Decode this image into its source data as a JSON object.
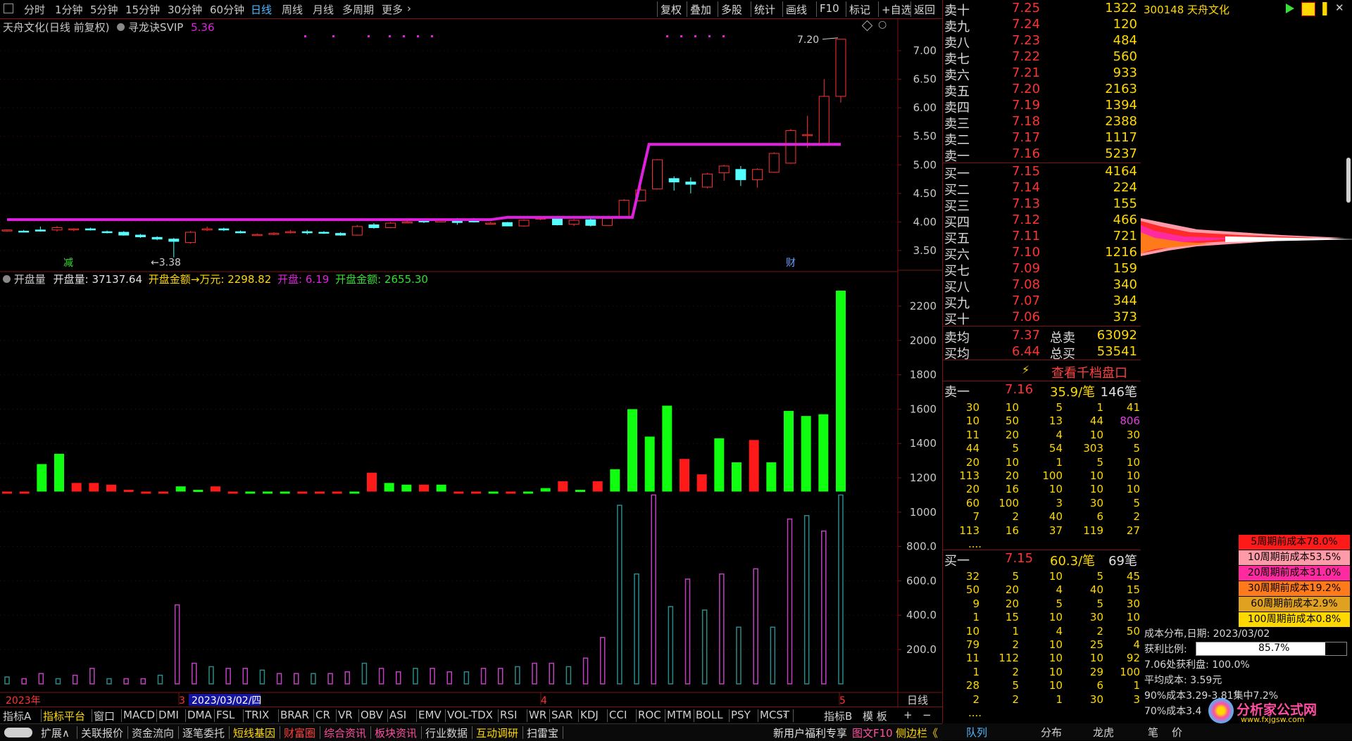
{
  "toolbar": {
    "periods": [
      "分时",
      "1分钟",
      "5分钟",
      "15分钟",
      "30分钟",
      "60分钟",
      "日线",
      "周线",
      "月线",
      "多周期",
      "更多"
    ],
    "active_period": "日线",
    "right_buttons": [
      "复权",
      "叠加",
      "多股",
      "统计",
      "画线",
      "F10",
      "标记",
      "+自选",
      "返回"
    ]
  },
  "main_chart": {
    "title": "天舟文化(日线 前复权)",
    "indicator_name": "寻龙诀SVIP",
    "indicator_value": "5.36",
    "high_label": "7.20",
    "low_label": "3.38",
    "y_ticks": [
      "7.00",
      "6.50",
      "6.00",
      "5.50",
      "5.00",
      "4.50",
      "4.00",
      "3.50"
    ],
    "marker_jian": "减",
    "marker_cai": "财"
  },
  "sub_chart": {
    "name": "开盘量",
    "label1": "开盘量",
    "value1": "37137.64",
    "label2": "开盘金额→万元",
    "value2": "2298.82",
    "label3": "开盘",
    "value3": "6.19",
    "label4": "开盘金额",
    "value4": "2655.30",
    "y_ticks": [
      "2200",
      "2000",
      "1800",
      "1600",
      "1400",
      "1200",
      "1000",
      "800.0",
      "600.0",
      "400.0",
      "200.0"
    ]
  },
  "x_axis": {
    "year_label": "2023年",
    "month3": "3",
    "cursor_date": "2023/03/02/四",
    "month4": "4",
    "month5": "5",
    "period_label": "日线"
  },
  "chart_data": {
    "type": "candlestick",
    "candles": [
      [
        3.85,
        3.87,
        3.83,
        3.86
      ],
      [
        3.84,
        3.86,
        3.82,
        3.83
      ],
      [
        3.86,
        3.92,
        3.83,
        3.84
      ],
      [
        3.86,
        3.93,
        3.83,
        3.9
      ],
      [
        3.87,
        3.89,
        3.84,
        3.88
      ],
      [
        3.88,
        3.9,
        3.85,
        3.86
      ],
      [
        3.83,
        3.85,
        3.8,
        3.82
      ],
      [
        3.82,
        3.84,
        3.76,
        3.77
      ],
      [
        3.77,
        3.79,
        3.72,
        3.74
      ],
      [
        3.73,
        3.75,
        3.68,
        3.7
      ],
      [
        3.7,
        3.72,
        3.38,
        3.66
      ],
      [
        3.64,
        3.84,
        3.62,
        3.82
      ],
      [
        3.86,
        3.92,
        3.84,
        3.88
      ],
      [
        3.88,
        3.9,
        3.84,
        3.86
      ],
      [
        3.83,
        3.85,
        3.8,
        3.81
      ],
      [
        3.78,
        3.8,
        3.76,
        3.78
      ],
      [
        3.79,
        3.82,
        3.77,
        3.8
      ],
      [
        3.82,
        3.86,
        3.8,
        3.83
      ],
      [
        3.83,
        3.86,
        3.78,
        3.81
      ],
      [
        3.82,
        3.84,
        3.79,
        3.81
      ],
      [
        3.8,
        3.82,
        3.76,
        3.77
      ],
      [
        3.77,
        3.95,
        3.76,
        3.92
      ],
      [
        3.95,
        3.98,
        3.88,
        3.9
      ],
      [
        3.9,
        4.0,
        3.89,
        3.98
      ],
      [
        3.99,
        4.02,
        3.98,
        4.0
      ],
      [
        4.02,
        4.04,
        3.98,
        4.0
      ],
      [
        4.0,
        4.05,
        3.99,
        4.03
      ],
      [
        4.05,
        4.07,
        3.95,
        3.99
      ],
      [
        4.02,
        4.07,
        3.99,
        4.0
      ],
      [
        3.97,
        4.0,
        3.96,
        3.98
      ],
      [
        3.99,
        4.0,
        3.93,
        3.93
      ],
      [
        3.93,
        4.04,
        3.92,
        4.03
      ],
      [
        4.05,
        4.09,
        4.03,
        4.08
      ],
      [
        4.06,
        4.08,
        3.94,
        3.95
      ],
      [
        3.96,
        4.05,
        3.93,
        4.03
      ],
      [
        4.04,
        4.08,
        3.92,
        3.94
      ],
      [
        3.94,
        4.07,
        3.94,
        4.06
      ],
      [
        4.09,
        4.4,
        4.08,
        4.38
      ],
      [
        4.37,
        4.62,
        4.36,
        4.56
      ],
      [
        4.58,
        5.1,
        4.57,
        5.09
      ],
      [
        4.76,
        4.8,
        4.55,
        4.7
      ],
      [
        4.7,
        4.78,
        4.5,
        4.66
      ],
      [
        4.61,
        4.86,
        4.59,
        4.84
      ],
      [
        4.86,
        5.0,
        4.72,
        4.98
      ],
      [
        4.92,
        4.98,
        4.63,
        4.74
      ],
      [
        4.74,
        4.94,
        4.6,
        4.92
      ],
      [
        4.87,
        5.22,
        4.86,
        5.2
      ],
      [
        5.03,
        5.63,
        5.02,
        5.6
      ],
      [
        5.53,
        5.86,
        5.3,
        5.53
      ],
      [
        5.36,
        6.5,
        5.35,
        6.2
      ],
      [
        6.2,
        7.2,
        6.09,
        7.2
      ]
    ],
    "trend_line": {
      "level_1": 4.04,
      "level_2": 4.08,
      "level_3": 5.36
    },
    "volume_top_bars": [
      1120,
      1120,
      1280,
      1340,
      1170,
      1170,
      1160,
      1130,
      1120,
      1120,
      1150,
      1130,
      1150,
      1120,
      1120,
      1120,
      1120,
      1120,
      1120,
      1120,
      1120,
      1230,
      1170,
      1160,
      1160,
      1160,
      1120,
      1120,
      1120,
      1120,
      1120,
      1140,
      1180,
      1130,
      1180,
      1250,
      1600,
      1440,
      1620,
      1310,
      1220,
      1430,
      1290,
      1420,
      1290,
      1590,
      1560,
      1570,
      2290
    ],
    "volume_low_bars": [
      40,
      30,
      60,
      30,
      50,
      90,
      30,
      30,
      30,
      50,
      460,
      120,
      100,
      90,
      90,
      80,
      60,
      60,
      60,
      60,
      70,
      120,
      90,
      70,
      90,
      90,
      70,
      70,
      90,
      90,
      100,
      120,
      120,
      100,
      150,
      270,
      1040,
      640,
      1100,
      450,
      610,
      430,
      640,
      330,
      670,
      330,
      960,
      980,
      890,
      1100
    ],
    "ylim_price": [
      3.2,
      7.5
    ],
    "ylim_volume": [
      0,
      2300
    ]
  },
  "order_book": {
    "sells": [
      {
        "label": "卖十",
        "price": "7.25",
        "vol": "1322"
      },
      {
        "label": "卖九",
        "price": "7.24",
        "vol": "120"
      },
      {
        "label": "卖八",
        "price": "7.23",
        "vol": "484"
      },
      {
        "label": "卖七",
        "price": "7.22",
        "vol": "560"
      },
      {
        "label": "卖六",
        "price": "7.21",
        "vol": "933"
      },
      {
        "label": "卖五",
        "price": "7.20",
        "vol": "2163"
      },
      {
        "label": "卖四",
        "price": "7.19",
        "vol": "1394"
      },
      {
        "label": "卖三",
        "price": "7.18",
        "vol": "2388"
      },
      {
        "label": "卖二",
        "price": "7.17",
        "vol": "1117"
      },
      {
        "label": "卖一",
        "price": "7.16",
        "vol": "5237"
      }
    ],
    "buys": [
      {
        "label": "买一",
        "price": "7.15",
        "vol": "4164"
      },
      {
        "label": "买二",
        "price": "7.14",
        "vol": "224"
      },
      {
        "label": "买三",
        "price": "7.13",
        "vol": "155"
      },
      {
        "label": "买四",
        "price": "7.12",
        "vol": "466"
      },
      {
        "label": "买五",
        "price": "7.11",
        "vol": "721"
      },
      {
        "label": "买六",
        "price": "7.10",
        "vol": "1216"
      },
      {
        "label": "买七",
        "price": "7.09",
        "vol": "159"
      },
      {
        "label": "买八",
        "price": "7.08",
        "vol": "340"
      },
      {
        "label": "买九",
        "price": "7.07",
        "vol": "344"
      },
      {
        "label": "买十",
        "price": "7.06",
        "vol": "373"
      }
    ],
    "avg_sell_label": "卖均",
    "avg_sell": "7.37",
    "total_sell_label": "总卖",
    "total_sell": "63092",
    "avg_buy_label": "买均",
    "avg_buy": "6.44",
    "total_buy_label": "总买",
    "total_buy": "53541",
    "view_1000": "查看千档盘口"
  },
  "queue_sell": {
    "label": "卖一",
    "price": "7.16",
    "avg": "35.9/笔",
    "count": "146笔",
    "rows": [
      [
        "30",
        "10",
        "5",
        "1",
        "41"
      ],
      [
        "10",
        "50",
        "13",
        "44",
        "806"
      ],
      [
        "11",
        "20",
        "4",
        "10",
        "30"
      ],
      [
        "44",
        "5",
        "54",
        "303",
        "5"
      ],
      [
        "20",
        "10",
        "1",
        "5",
        "10"
      ],
      [
        "113",
        "20",
        "100",
        "10",
        "10"
      ],
      [
        "20",
        "16",
        "10",
        "10",
        "10"
      ],
      [
        "60",
        "100",
        "3",
        "30",
        "5"
      ],
      [
        "7",
        "2",
        "40",
        "6",
        "2"
      ],
      [
        "113",
        "16",
        "37",
        "119",
        "27"
      ]
    ]
  },
  "queue_buy": {
    "label": "买一",
    "price": "7.15",
    "avg": "60.3/笔",
    "count": "69笔",
    "rows": [
      [
        "32",
        "5",
        "10",
        "5",
        "45"
      ],
      [
        "50",
        "20",
        "4",
        "40",
        "15"
      ],
      [
        "9",
        "20",
        "5",
        "5",
        "30"
      ],
      [
        "1",
        "15",
        "10",
        "30",
        "10"
      ],
      [
        "10",
        "1",
        "4",
        "2",
        "50"
      ],
      [
        "79",
        "2",
        "10",
        "25",
        "4"
      ],
      [
        "11",
        "112",
        "10",
        "10",
        "92"
      ],
      [
        "1",
        "2",
        "10",
        "29",
        "100"
      ],
      [
        "28",
        "5",
        "10",
        "6",
        "1"
      ],
      [
        "2",
        "2",
        "1",
        "30",
        "3"
      ]
    ]
  },
  "ellipsis": "....",
  "stock": {
    "code": "300148",
    "name": "天舟文化"
  },
  "cost_legend": [
    {
      "text": "5周期前成本78.0%",
      "color": "#ff1a1a"
    },
    {
      "text": "10周期前成本53.5%",
      "color": "#ff9aa8"
    },
    {
      "text": "20周期前成本31.0%",
      "color": "#ff2aa0"
    },
    {
      "text": "30周期前成本19.2%",
      "color": "#ff7a1a"
    },
    {
      "text": "60周期前成本2.9%",
      "color": "#e0a020"
    },
    {
      "text": "100周期前成本0.8%",
      "color": "#ffd800"
    }
  ],
  "cost_info": {
    "date_line": "成本分布,日期: 2023/03/02",
    "profit_label": "获利比例:",
    "profit_pct": 85.7,
    "profit_text": "85.7%",
    "profit_at": "7.06处获利盘: 100.0%",
    "avg_cost": "平均成本: 3.59元",
    "cost90": "90%成本3.29-3.81集中7.2%",
    "cost70": "70%成本3.4"
  },
  "indicator_tabs": [
    "指标A",
    "指标平台",
    "窗口",
    "MACD",
    "DMI",
    "DMA",
    "FSL",
    "TRIX",
    "BRAR",
    "CR",
    "VR",
    "OBV",
    "ASI",
    "EMV",
    "VOL-TDX",
    "RSI",
    "WR",
    "SAR",
    "KDJ",
    "CCI",
    "ROC",
    "MTM",
    "BOLL",
    "PSY",
    "MCST"
  ],
  "indicator_right": [
    "指标B",
    "模 板",
    "+",
    "−"
  ],
  "bottom_tabs": [
    "扩展∧",
    "关联报价",
    "资金流向",
    "逐笔委托",
    "短线基因",
    "财富圈",
    "综合资讯",
    "板块资讯",
    "行业数据",
    "互动调研",
    "扫雷宝"
  ],
  "bottom_right_text": "新用户福利专享",
  "bottom_f10": "图文F10",
  "bottom_side": "侧边栏《",
  "panel_tabs": [
    "队列",
    "分布",
    "龙虎",
    "笔",
    "价"
  ],
  "watermark": "分析家公式网",
  "watermark_url": "www.fxjgsw.com",
  "colors": {
    "up": "#ff3232",
    "down": "#54ffff",
    "green_bar": "#10ff10",
    "line": "#e020e0",
    "axis": "#7a1414"
  }
}
